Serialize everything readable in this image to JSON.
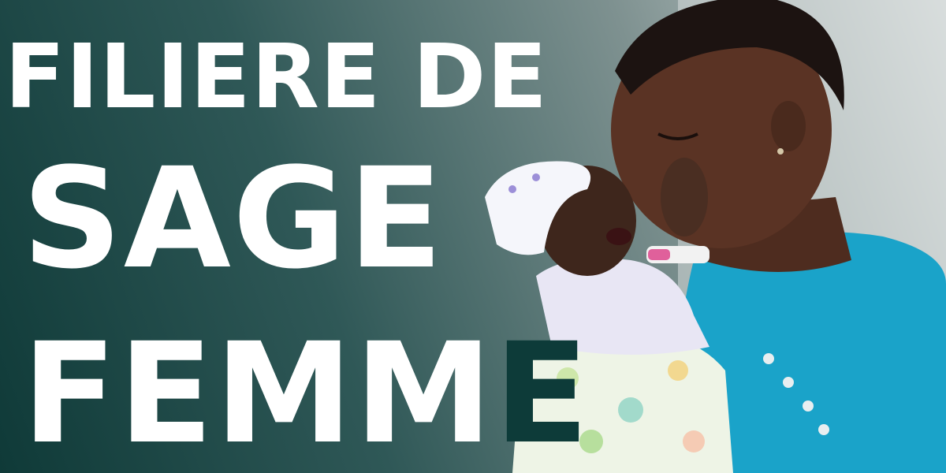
{
  "headline": {
    "line1": "FILIERE DE",
    "line2": "SAGE",
    "line3_main": "FEMM",
    "line3_last": "E"
  },
  "colors": {
    "background_dark": "#0f3a38",
    "background_light": "#d3d9d8",
    "text_primary": "#ffffff",
    "text_accent": "#0d3b39",
    "shirt": "#1aa3c9",
    "skin": "#5a3324",
    "blanket": "#eef4e6"
  },
  "image": {
    "subject": "mother-holding-newborn-photo"
  }
}
